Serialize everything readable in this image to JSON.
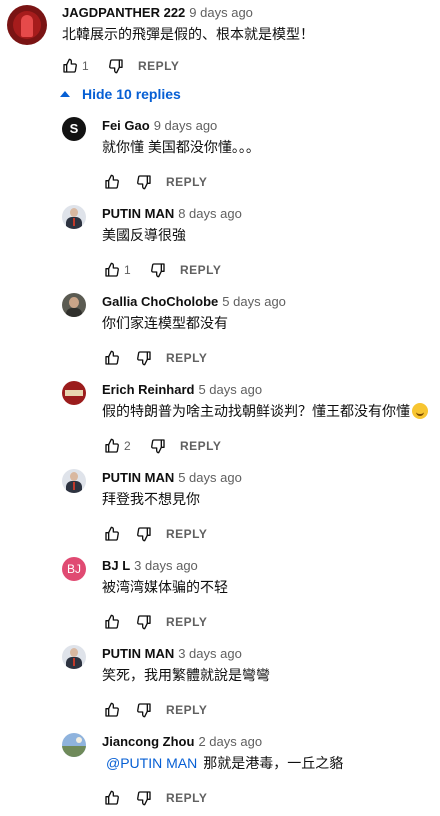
{
  "top_comment": {
    "author": "JAGDPANTHER 222",
    "time": "9 days ago",
    "text": "北韓展示的飛彈是假的、根本就是模型！",
    "likes": "1",
    "reply_label": "REPLY"
  },
  "replies_toggle": {
    "label": "Hide 10 replies",
    "icon": "chevron-up-icon"
  },
  "colors": {
    "link_blue": "#065fd4",
    "meta_gray": "#606060",
    "text": "#0f0f0f"
  },
  "replies": [
    {
      "author": "Fei Gao",
      "time": "9 days ago",
      "mention": "",
      "text": "就你懂 美国都没你懂。。。",
      "likes": "",
      "reply_label": "REPLY",
      "avatar_letter": "S"
    },
    {
      "author": "PUTIN MAN",
      "time": "8 days ago",
      "mention": "",
      "text": "美國反導很強",
      "likes": "1",
      "reply_label": "REPLY"
    },
    {
      "author": "Gallia ChoCholobe",
      "time": "5 days ago",
      "mention": "",
      "text": "你们家连模型都没有",
      "likes": "",
      "reply_label": "REPLY"
    },
    {
      "author": "Erich Reinhard",
      "time": "5 days ago",
      "mention": "",
      "text": "假的特朗普为啥主动找朝鲜谈判？懂王都没有你懂",
      "likes": "2",
      "reply_label": "REPLY",
      "emoji": "grinning-face"
    },
    {
      "author": "PUTIN MAN",
      "time": "5 days ago",
      "mention": "",
      "text": "拜登我不想見你",
      "likes": "",
      "reply_label": "REPLY"
    },
    {
      "author": "BJ L",
      "time": "3 days ago",
      "mention": "",
      "text": "被湾湾媒体骗的不轻",
      "likes": "",
      "reply_label": "REPLY",
      "avatar_letter": "BJ"
    },
    {
      "author": "PUTIN MAN",
      "time": "3 days ago",
      "mention": "",
      "text": "笑死，我用繁體就說是彎彎",
      "likes": "",
      "reply_label": "REPLY"
    },
    {
      "author": "Jiancong Zhou",
      "time": "2 days ago",
      "mention": "@PUTIN MAN",
      "text": "那就是港毒，一丘之貉",
      "likes": "",
      "reply_label": "REPLY"
    }
  ]
}
